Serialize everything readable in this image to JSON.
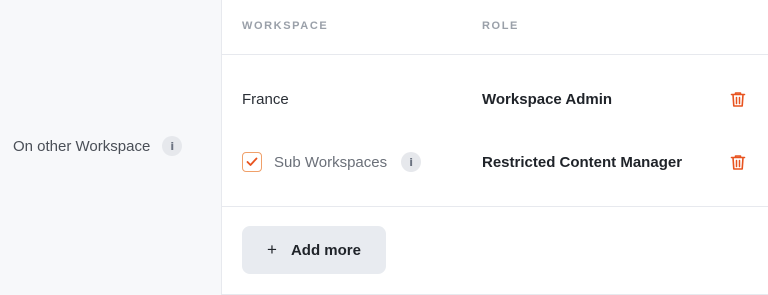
{
  "left_label": {
    "text": "On other Workspace",
    "info_icon": "info-icon"
  },
  "table": {
    "headers": {
      "workspace": "WORKSPACE",
      "role": "ROLE"
    },
    "rows": [
      {
        "workspace": "France",
        "role": "Workspace Admin",
        "has_checkbox": false
      },
      {
        "workspace": "Sub Workspaces",
        "role": "Restricted Content Manager",
        "has_checkbox": true,
        "checked": true
      }
    ]
  },
  "actions": {
    "add_more_label": "Add more",
    "plus": "+"
  },
  "colors": {
    "accent": "#e8531f",
    "checkbox_border": "#f0a06a",
    "button_bg": "#e8ebf0"
  }
}
